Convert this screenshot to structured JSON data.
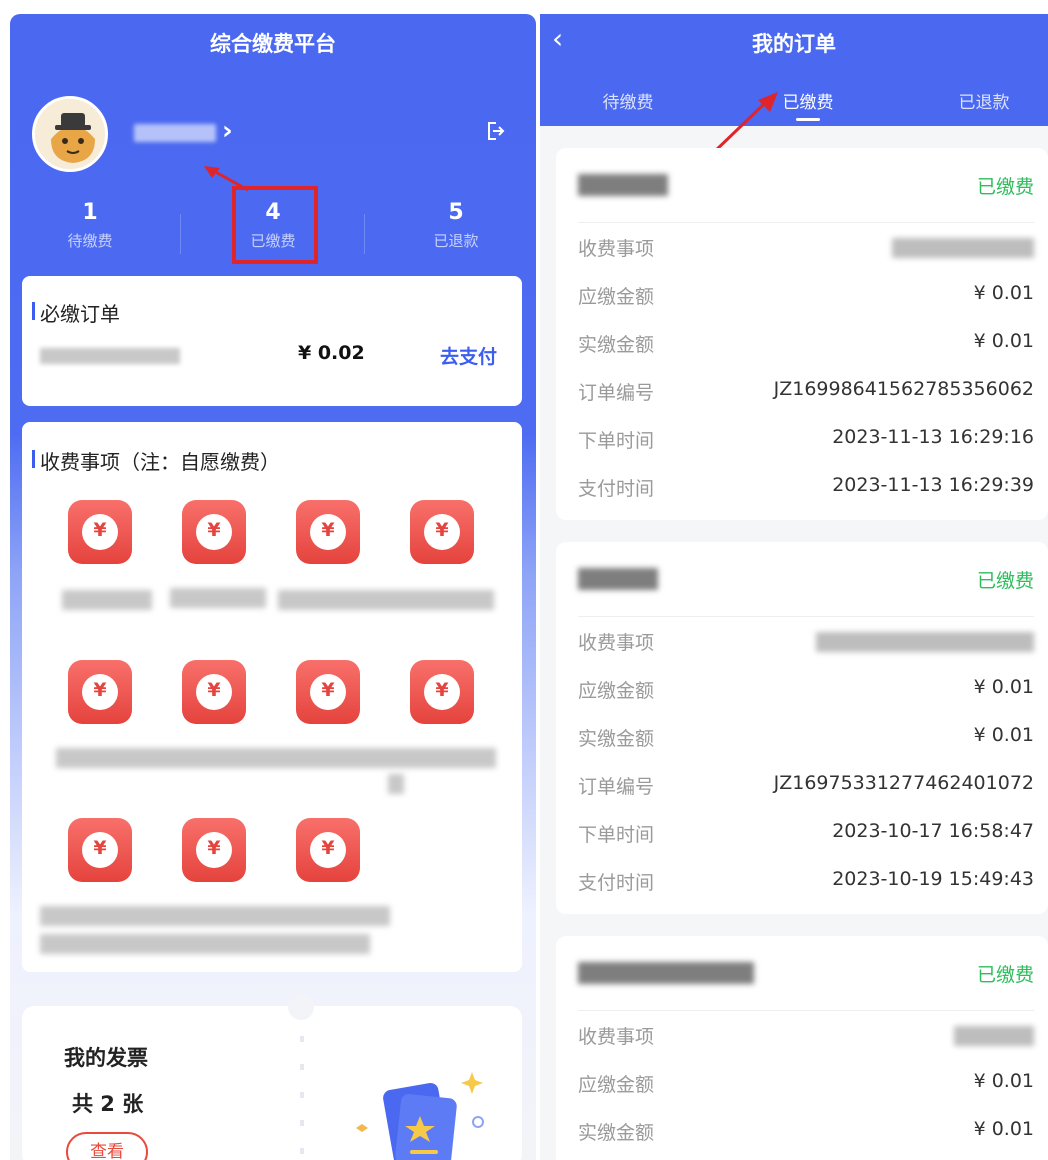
{
  "left": {
    "header_title": "综合缴费平台",
    "chevron": "›",
    "stats": [
      {
        "num": "1",
        "label": "待缴费"
      },
      {
        "num": "4",
        "label": "已缴费"
      },
      {
        "num": "5",
        "label": "已退款"
      }
    ],
    "required": {
      "title": "必缴订单",
      "price": "¥ 0.02",
      "pay": "去支付"
    },
    "fees": {
      "title": "收费事项（注：自愿缴费）"
    },
    "invoice": {
      "title": "我的发票",
      "count": "共 2 张",
      "btn": "查看"
    }
  },
  "right": {
    "back": "‹",
    "title": "我的订单",
    "tabs": [
      "待缴费",
      "已缴费",
      "已退款"
    ],
    "orders": [
      {
        "status": "已缴费",
        "rows": [
          {
            "k": "收费事项",
            "v": ""
          },
          {
            "k": "应缴金额",
            "v": "¥ 0.01"
          },
          {
            "k": "实缴金额",
            "v": "¥ 0.01"
          },
          {
            "k": "订单编号",
            "v": "JZ16998641562785356062"
          },
          {
            "k": "下单时间",
            "v": "2023-11-13 16:29:16"
          },
          {
            "k": "支付时间",
            "v": "2023-11-13 16:29:39"
          }
        ]
      },
      {
        "status": "已缴费",
        "rows": [
          {
            "k": "收费事项",
            "v": ""
          },
          {
            "k": "应缴金额",
            "v": "¥ 0.01"
          },
          {
            "k": "实缴金额",
            "v": "¥ 0.01"
          },
          {
            "k": "订单编号",
            "v": "JZ16975331277462401072"
          },
          {
            "k": "下单时间",
            "v": "2023-10-17 16:58:47"
          },
          {
            "k": "支付时间",
            "v": "2023-10-19 15:49:43"
          }
        ]
      },
      {
        "status": "已缴费",
        "rows": [
          {
            "k": "收费事项",
            "v": ""
          },
          {
            "k": "应缴金额",
            "v": "¥ 0.01"
          },
          {
            "k": "实缴金额",
            "v": "¥ 0.01"
          }
        ]
      }
    ]
  },
  "colors": {
    "brand": "#4a68f0",
    "paid_green": "#2dbd5c",
    "accent_red": "#e0242b",
    "icon_red": "#e5433d",
    "link_blue": "#3b5ef0"
  }
}
